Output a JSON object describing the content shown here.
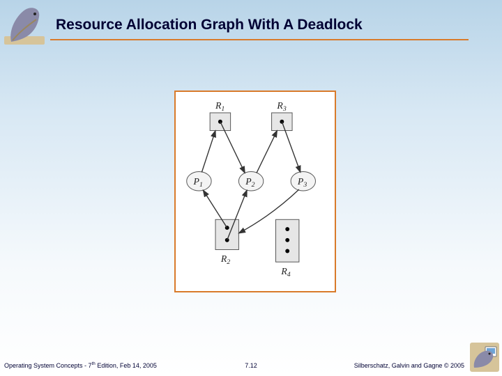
{
  "title": "Resource Allocation Graph With A Deadlock",
  "labels": {
    "R1": "R",
    "R1s": "1",
    "R2": "R",
    "R2s": "2",
    "R3": "R",
    "R3s": "3",
    "R4": "R",
    "R4s": "4",
    "P1": "P",
    "P1s": "1",
    "P2": "P",
    "P2s": "2",
    "P3": "P",
    "P3s": "3"
  },
  "resources": {
    "R1": {
      "instances": 1
    },
    "R2": {
      "instances": 2
    },
    "R3": {
      "instances": 1
    },
    "R4": {
      "instances": 3
    }
  },
  "edges": {
    "request": [
      {
        "from": "P1",
        "to": "R1"
      },
      {
        "from": "P2",
        "to": "R3"
      },
      {
        "from": "P3",
        "to": "R2"
      }
    ],
    "assignment": [
      {
        "from": "R1",
        "to": "P2"
      },
      {
        "from": "R2",
        "to": "P1"
      },
      {
        "from": "R2",
        "to": "P2"
      },
      {
        "from": "R3",
        "to": "P3"
      }
    ]
  },
  "footer": {
    "left_a": "Operating System Concepts - 7",
    "left_sup": "th",
    "left_b": " Edition, Feb 14, 2005",
    "center": "7.12",
    "right": "Silberschatz, Galvin and Gagne © 2005"
  }
}
